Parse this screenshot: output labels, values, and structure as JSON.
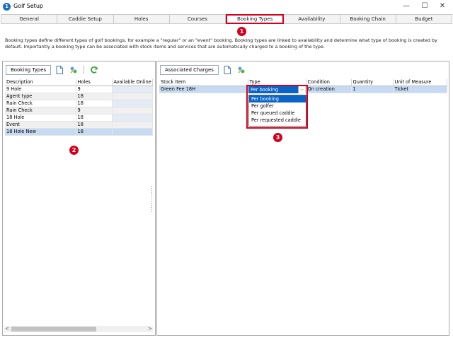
{
  "window": {
    "title": "Golf Setup",
    "app_icon_glyph": "1",
    "minimize": "—",
    "maximize": "☐",
    "close": "✕"
  },
  "tabs": [
    {
      "label": "General",
      "active": false
    },
    {
      "label": "Caddie Setup",
      "active": false
    },
    {
      "label": "Holes",
      "active": false
    },
    {
      "label": "Courses",
      "active": false
    },
    {
      "label": "Booking Types",
      "active": true
    },
    {
      "label": "Availability",
      "active": false
    },
    {
      "label": "Booking Chain",
      "active": false
    },
    {
      "label": "Budget",
      "active": false
    }
  ],
  "description": "Booking types define different types of golf bookings, for example a \"regular\" or an \"event\" booking. Booking types are linked to availability and determine what type of booking is created by default. Importantly a booking type can be associated with stock items and services that are automatically charged to a booking of the type.",
  "callouts": {
    "c1": "1",
    "c2": "2",
    "c3": "3"
  },
  "booking_types": {
    "toolbar_label": "Booking Types",
    "columns": [
      "Description",
      "Holes",
      "Available Online"
    ],
    "rows": [
      {
        "description": "9 Hole",
        "holes": "9",
        "available": ""
      },
      {
        "description": "Agent type",
        "holes": "18",
        "available": ""
      },
      {
        "description": "Rain Check",
        "holes": "18",
        "available": ""
      },
      {
        "description": "Rain Check",
        "holes": "9",
        "available": ""
      },
      {
        "description": "18 Hole",
        "holes": "18",
        "available": ""
      },
      {
        "description": "Event",
        "holes": "18",
        "available": ""
      },
      {
        "description": "18 Hole New",
        "holes": "18",
        "available": ""
      }
    ],
    "scroll_left": "<",
    "scroll_right": ">"
  },
  "associated_charges": {
    "toolbar_label": "Associated Charges",
    "columns": [
      "Stock Item",
      "Type",
      "Condition",
      "Quantity",
      "Unit of Measure"
    ],
    "rows": [
      {
        "stock_item": "Green Fee 18H",
        "type": "",
        "condition": "On creation",
        "quantity": "1",
        "unit": "Ticket"
      }
    ],
    "type_dropdown": {
      "value": "Per booking",
      "arrow": "⌵",
      "options": [
        "Per booking",
        "Per golfer",
        "Per queued caddie",
        "Per requested caddie"
      ]
    }
  },
  "colors": {
    "accent_red": "#d6001c",
    "selection_blue": "#0a64c8",
    "row_selected": "#c6daf3"
  }
}
